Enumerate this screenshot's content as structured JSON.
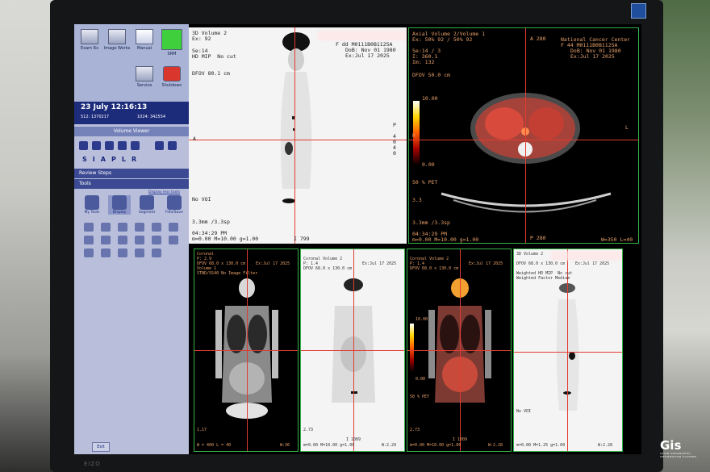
{
  "panel": {
    "apps": [
      "Exam Rx",
      "Image Works",
      "Manual",
      "SRM",
      "Service",
      "Shutdown"
    ],
    "datetime": "23 July 12:16:13",
    "mem_left": "512:  1370217",
    "mem_right": "1024:  342554",
    "volume_viewer": "Volume Viewer",
    "letters": [
      "S",
      "I",
      "A",
      "P",
      "L",
      "R"
    ],
    "review_steps": "Review Steps",
    "tools": "Tools",
    "display_less": "Display less tools",
    "big_tools": [
      "My Tools",
      "Display",
      "Segment",
      "Film/Save"
    ],
    "exit": "Exit"
  },
  "viewports": {
    "v3d": {
      "title": "3D Volume 2",
      "ex": "Ex: 92",
      "se": "Se:14",
      "mode": "HD MIP  No cut",
      "dfov": "DFOV 80.1 cm",
      "patient": "F dd M0111B0B1125A",
      "dob": "DoB: Nov 01 1980",
      "exdate": "Ex:Jul 17 2025",
      "novoi": "No VOI",
      "thick": "3.3mm /3.3sp",
      "time": "04:34:29 PM",
      "wl": "m=0.00 M=10.00 g=1.00",
      "img": "I 799",
      "marks_left": [
        "A"
      ],
      "marks_right": [
        "P",
        "4",
        "0",
        "4",
        "0"
      ]
    },
    "axial": {
      "title": "Axial Volume 2/Volume 1",
      "ex": "Ex: 50% 92 / 50% 92",
      "se": "Se:14 / 3",
      "im1": "I: 360.1",
      "im2": "Im: 132",
      "dfov": "DFOV 50.0 cm",
      "patient": "National Cancer Center",
      "pat2": "F 44 M0111B0B1125A",
      "dob": "DoB: Nov 01 1980",
      "exdate": "Ex:Jul 17 2025",
      "scale_top": "10.00",
      "scale_bottom": "0.00",
      "pet": "50 % PET",
      "val": "3.3",
      "thick": "3.3mm /3.3sp",
      "time": "04:34:29 PM",
      "wl": "m=0.00 M=10.00 g=1.00",
      "a": "A 280",
      "p": "P 280",
      "r": "R",
      "l": "L",
      "wlr": "W=350 L=40"
    },
    "cor1": {
      "title": "Coronal",
      "p": "P: 2.9",
      "dfov": "DFOV 68.0 x 130.0 cm",
      "ex": "Ex:Jul 17 2025",
      "vol": "Volume 1",
      "filt": "STND/SS40 No Image Filter",
      "val": "1.17",
      "wl": "W = 400 L = 40",
      "wr": "W:36"
    },
    "cor2": {
      "title": "Coronal Volume 2",
      "p": "P: 1.4",
      "dfov": "DFOV 68.0 x 130.0 cm",
      "ex": "Ex:Jul 17 2025",
      "val": "2.73",
      "wl": "m=0.00 M=10.00 g=1.00",
      "img": "I 1009",
      "wr": "W:2.29"
    },
    "cor3": {
      "title": "Coronal Volume 2",
      "p": "P: 1.4",
      "dfov": "DFOV 68.0 x 130.0 cm",
      "ex": "Ex:Jul 17 2025",
      "scale_top": "10.00",
      "scale_bottom": "0.00",
      "pet": "50 % PET",
      "val": "2.73",
      "wl": "m=0.00 M=10.00 g=1.00",
      "img": "I 1009",
      "wr": "W:2.28"
    },
    "mip2": {
      "title": "3D Volume 2",
      "dfov": "DFOV 68.0 x 130.0 cm",
      "ex": "Ex:Jul 17 2025",
      "mode": "Weighted HD MIP  No cut",
      "factor": "Weighted Factor Medium",
      "novoi": "No VOI",
      "wl": "m=0.00 M=1.25 g=1.00",
      "wr": "W:2.28"
    }
  },
  "brand": "EIZO",
  "watermark": "Gis",
  "watermark_sub": "ASIAN GEOGRAPHIC INFORMATION SYSTEMS"
}
